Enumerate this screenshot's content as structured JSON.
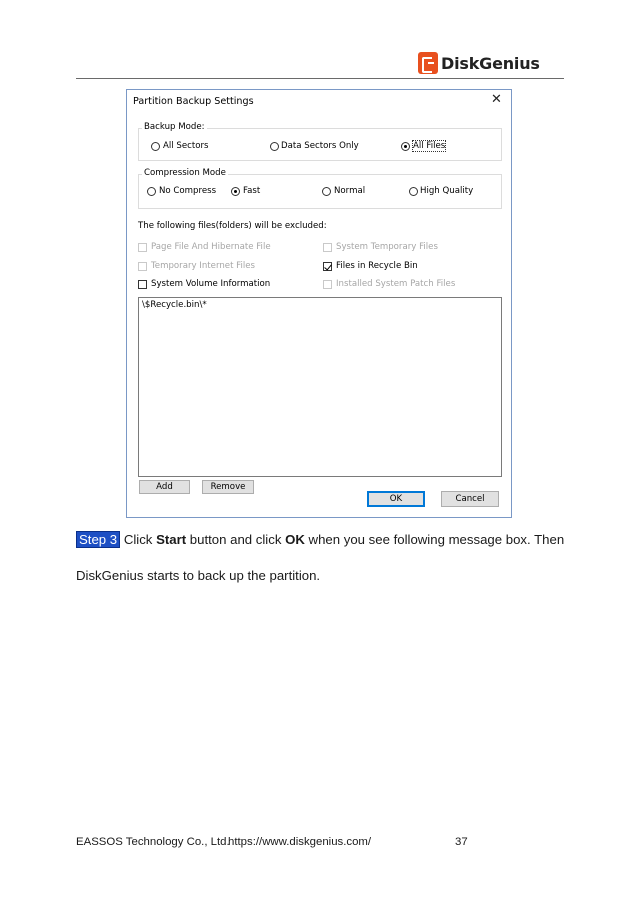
{
  "header": {
    "brand": "DiskGenius"
  },
  "dialog": {
    "title": "Partition Backup Settings",
    "close_glyph": "✕",
    "backup_mode": {
      "label": "Backup Mode:",
      "options": [
        "All Sectors",
        "Data Sectors Only",
        "All Files"
      ],
      "selected": "All Files"
    },
    "compression_mode": {
      "label": "Compression Mode",
      "options": [
        "No Compress",
        "Fast",
        "Normal",
        "High Quality"
      ],
      "selected": "Fast"
    },
    "exclusion_label": "The following files(folders) will be excluded:",
    "exclusions": {
      "page_file": "Page File And Hibernate File",
      "system_temp": "System Temporary Files",
      "temp_internet": "Temporary Internet Files",
      "recycle_bin": "Files in Recycle Bin",
      "system_volume": "System Volume Information",
      "patch_files": "Installed System Patch Files"
    },
    "excluded_list": [
      "\\$Recycle.bin\\*"
    ],
    "buttons": {
      "add": "Add",
      "remove": "Remove",
      "ok": "OK",
      "cancel": "Cancel"
    }
  },
  "body": {
    "step_label": "Step 3",
    "text1": "Click",
    "start_word": "Start",
    "text2": "button and click",
    "ok_word": "OK",
    "text3": "when you see following message box. Then",
    "line2": "DiskGenius starts to back up the partition."
  },
  "footer": {
    "company": "EASSOS Technology Co., Ltd.",
    "url": "https://www.diskgenius.com/",
    "page_number": "37"
  }
}
